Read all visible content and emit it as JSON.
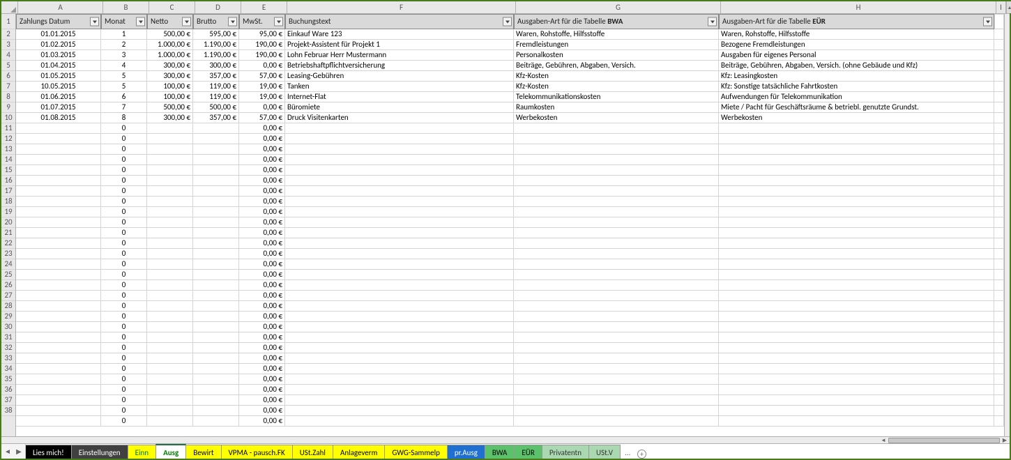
{
  "columns": {
    "letters": [
      "A",
      "B",
      "C",
      "D",
      "E",
      "F",
      "G",
      "H",
      "I"
    ],
    "headers": {
      "A": "Zahlungs Datum",
      "B": "Monat",
      "C": "Netto",
      "D": "Brutto",
      "E": "MwSt.",
      "F": "Buchungstext",
      "G_prefix": "Ausgaben-Art für die Tabelle ",
      "G_bold": "BWA",
      "H_prefix": "Ausgaben-Art für die Tabelle ",
      "H_bold": "EÜR"
    }
  },
  "rows_data": [
    {
      "A": "01.01.2015",
      "B": "1",
      "C": "500,00 €",
      "D": "595,00 €",
      "E": "95,00 €",
      "F": "Einkauf Ware 123",
      "G": "Waren, Rohstoffe, Hilfsstoffe",
      "H": "Waren, Rohstoffe, Hilfsstoffe"
    },
    {
      "A": "01.02.2015",
      "B": "2",
      "C": "1.000,00 €",
      "D": "1.190,00 €",
      "E": "190,00 €",
      "F": "Projekt-Assistent für Projekt 1",
      "G": "Fremdleistungen",
      "H": "Bezogene Fremdleistungen"
    },
    {
      "A": "01.03.2015",
      "B": "3",
      "C": "1.000,00 €",
      "D": "1.190,00 €",
      "E": "190,00 €",
      "F": "Lohn Februar Herr Mustermann",
      "G": "Personalkosten",
      "H": "Ausgaben für eigenes Personal"
    },
    {
      "A": "01.04.2015",
      "B": "4",
      "C": "300,00 €",
      "D": "300,00 €",
      "E": "0,00 €",
      "F": "Betriebshaftpflichtversicherung",
      "G": "Beiträge, Gebühren, Abgaben, Versich.",
      "H": "Beiträge, Gebühren, Abgaben, Versich. (ohne Gebäude und Kfz)"
    },
    {
      "A": "01.05.2015",
      "B": "5",
      "C": "300,00 €",
      "D": "357,00 €",
      "E": "57,00 €",
      "F": "Leasing-Gebühren",
      "G": "Kfz-Kosten",
      "H": "Kfz: Leasingkosten"
    },
    {
      "A": "10.05.2015",
      "B": "5",
      "C": "100,00 €",
      "D": "119,00 €",
      "E": "19,00 €",
      "F": "Tanken",
      "G": "Kfz-Kosten",
      "H": "Kfz: Sonstige tatsächliche Fahrtkosten"
    },
    {
      "A": "01.06.2015",
      "B": "6",
      "C": "100,00 €",
      "D": "119,00 €",
      "E": "19,00 €",
      "F": "Internet-Flat",
      "G": "Telekommunikationskosten",
      "H": "Aufwendungen für Telekommunikation"
    },
    {
      "A": "01.07.2015",
      "B": "7",
      "C": "500,00 €",
      "D": "500,00 €",
      "E": "0,00 €",
      "F": "Büromiete",
      "G": "Raumkosten",
      "H": "Miete / Pacht für Geschäftsräume & betriebl. genutzte Grundst."
    },
    {
      "A": "01.08.2015",
      "B": "8",
      "C": "300,00 €",
      "D": "357,00 €",
      "E": "57,00 €",
      "F": "Druck Visitenkarten",
      "G": "Werbekosten",
      "H": "Werbekosten"
    }
  ],
  "rows_empty": {
    "count": 29,
    "B": "0",
    "E": "0,00 €"
  },
  "row_numbers": {
    "start": 1,
    "end": 38
  },
  "sheet_tabs": [
    {
      "label": "Lies mich!",
      "bg": "#000000",
      "fg": "#ffffff"
    },
    {
      "label": "Einstellungen",
      "bg": "#404040",
      "fg": "#ffffff"
    },
    {
      "label": "Einn",
      "bg": "#ffff00",
      "fg": "#008000"
    },
    {
      "label": "Ausg",
      "bg": "#ffffff",
      "fg": "#008000",
      "active": true
    },
    {
      "label": "Bewirt",
      "bg": "#ffff00",
      "fg": "#000000"
    },
    {
      "label": "VPMA - pausch.FK",
      "bg": "#ffff00",
      "fg": "#000000"
    },
    {
      "label": "USt.Zahl",
      "bg": "#ffff00",
      "fg": "#000000"
    },
    {
      "label": "Anlageverm",
      "bg": "#ffff00",
      "fg": "#000000"
    },
    {
      "label": "GWG-Sammelp",
      "bg": "#ffff00",
      "fg": "#000000"
    },
    {
      "label": "pr.Ausg",
      "bg": "#1f6fd1",
      "fg": "#ffffff"
    },
    {
      "label": "BWA",
      "bg": "#5bc26b",
      "fg": "#000000"
    },
    {
      "label": "EÜR",
      "bg": "#5bc26b",
      "fg": "#000000"
    },
    {
      "label": "Privatentn",
      "bg": "#a9d8b1",
      "fg": "#333333"
    },
    {
      "label": "USt.V",
      "bg": "#a9d8b1",
      "fg": "#333333"
    }
  ],
  "overflow_indicator": "...",
  "nav": {
    "prev": "◄",
    "next": "▶"
  }
}
